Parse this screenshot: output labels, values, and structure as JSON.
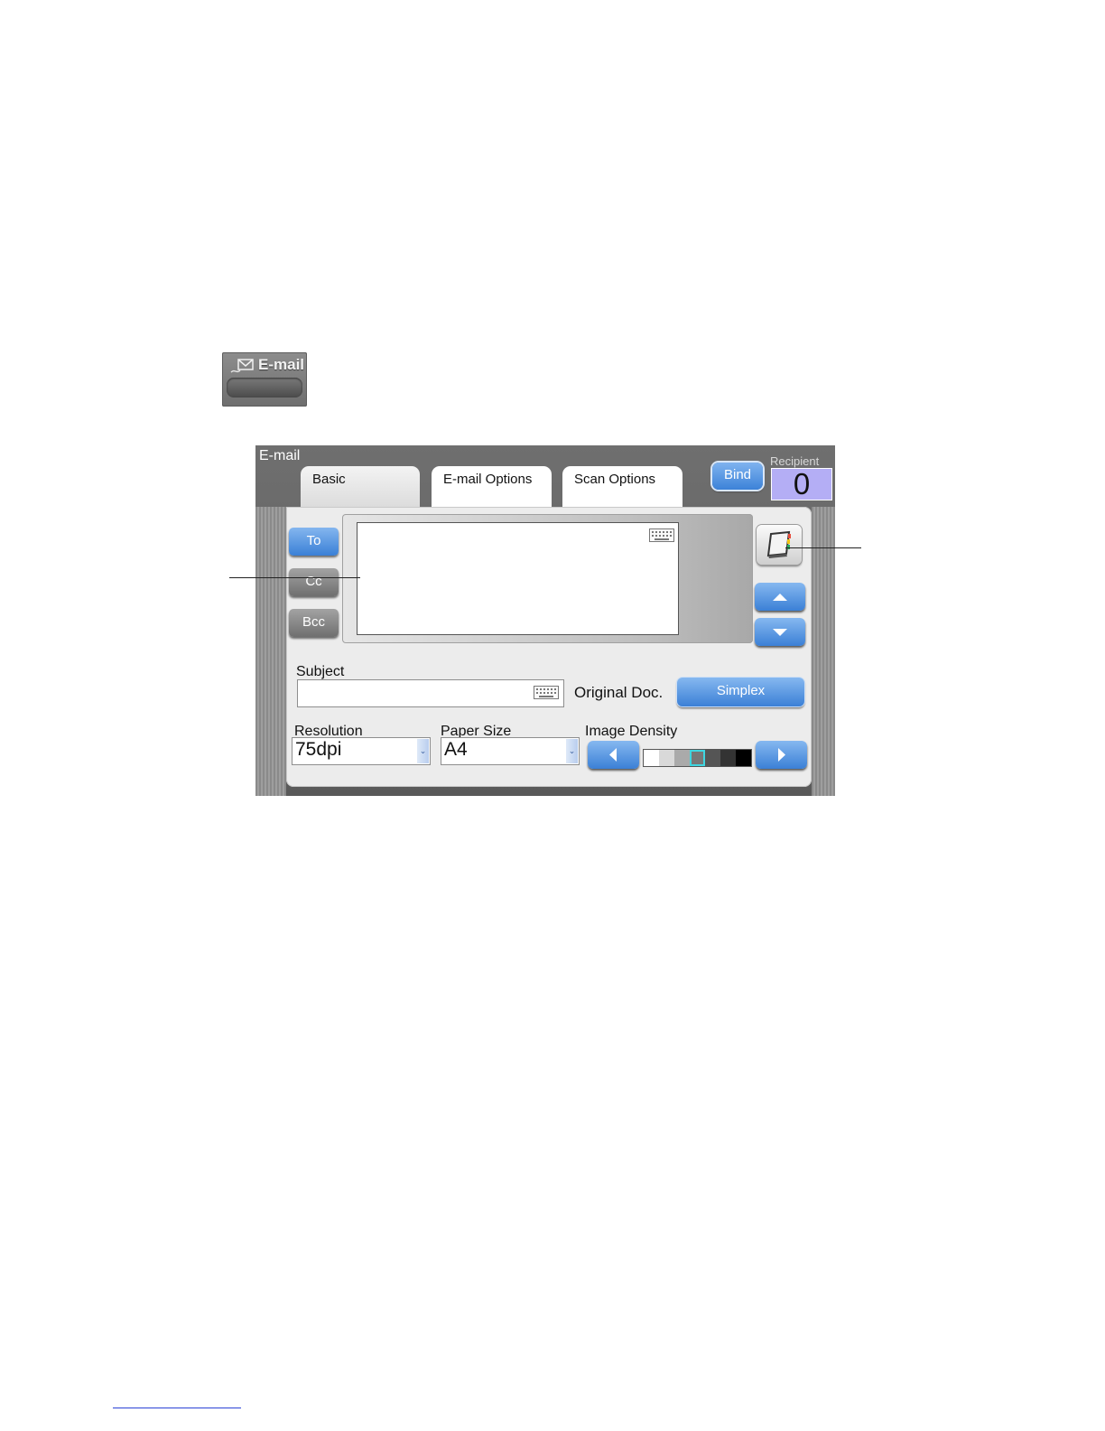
{
  "mode_button": {
    "label": "E-mail",
    "icon": "envelope-icon"
  },
  "panel": {
    "title": "E-mail",
    "tabs": [
      {
        "label": "Basic",
        "active": true
      },
      {
        "label": "E-mail Options",
        "active": false
      },
      {
        "label": "Scan Options",
        "active": false
      }
    ],
    "bind_label": "Bind",
    "recipient": {
      "label": "Recipient",
      "count": "0"
    }
  },
  "address": {
    "buttons": [
      {
        "label": "To",
        "style": "blue"
      },
      {
        "label": "Cc",
        "style": "grey"
      },
      {
        "label": "Bcc",
        "style": "grey"
      }
    ],
    "address_book_icon": "address-book-icon",
    "scroll_up_icon": "arrow-up-icon",
    "scroll_down_icon": "arrow-down-icon"
  },
  "subject": {
    "label": "Subject",
    "value": ""
  },
  "original_doc": {
    "label": "Original Doc.",
    "value": "Simplex"
  },
  "resolution": {
    "label": "Resolution",
    "value": "75dpi"
  },
  "paper_size": {
    "label": "Paper Size",
    "value": "A4"
  },
  "image_density": {
    "label": "Image Density",
    "levels": 7,
    "current_level": 4,
    "colors": [
      "#ffffff",
      "#d9d9d9",
      "#aaaaaa",
      "#777777",
      "#555555",
      "#333333",
      "#000000"
    ]
  },
  "colors": {
    "accent_blue": "#3b80d6",
    "recipient_box": "#b4aef5",
    "panel_grey": "#5e5e5e"
  }
}
